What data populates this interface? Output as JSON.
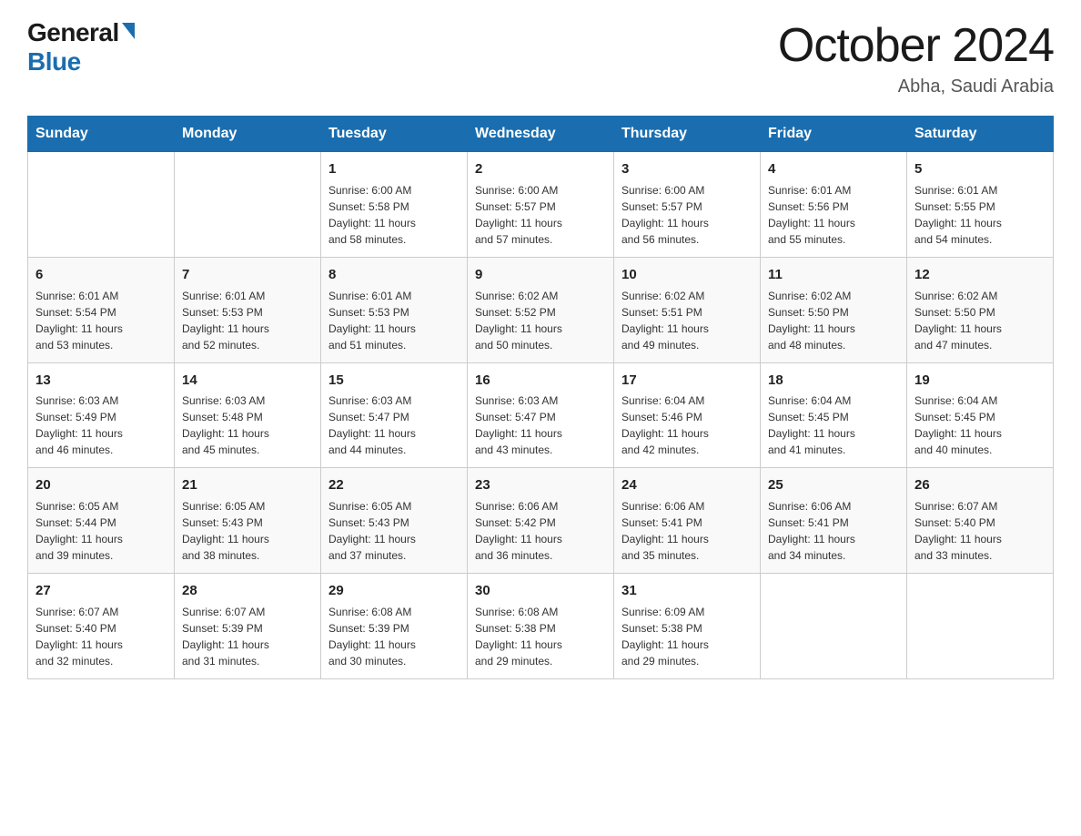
{
  "logo": {
    "general": "General",
    "blue": "Blue"
  },
  "title": "October 2024",
  "location": "Abha, Saudi Arabia",
  "headers": [
    "Sunday",
    "Monday",
    "Tuesday",
    "Wednesday",
    "Thursday",
    "Friday",
    "Saturday"
  ],
  "weeks": [
    [
      {
        "day": "",
        "info": ""
      },
      {
        "day": "",
        "info": ""
      },
      {
        "day": "1",
        "info": "Sunrise: 6:00 AM\nSunset: 5:58 PM\nDaylight: 11 hours\nand 58 minutes."
      },
      {
        "day": "2",
        "info": "Sunrise: 6:00 AM\nSunset: 5:57 PM\nDaylight: 11 hours\nand 57 minutes."
      },
      {
        "day": "3",
        "info": "Sunrise: 6:00 AM\nSunset: 5:57 PM\nDaylight: 11 hours\nand 56 minutes."
      },
      {
        "day": "4",
        "info": "Sunrise: 6:01 AM\nSunset: 5:56 PM\nDaylight: 11 hours\nand 55 minutes."
      },
      {
        "day": "5",
        "info": "Sunrise: 6:01 AM\nSunset: 5:55 PM\nDaylight: 11 hours\nand 54 minutes."
      }
    ],
    [
      {
        "day": "6",
        "info": "Sunrise: 6:01 AM\nSunset: 5:54 PM\nDaylight: 11 hours\nand 53 minutes."
      },
      {
        "day": "7",
        "info": "Sunrise: 6:01 AM\nSunset: 5:53 PM\nDaylight: 11 hours\nand 52 minutes."
      },
      {
        "day": "8",
        "info": "Sunrise: 6:01 AM\nSunset: 5:53 PM\nDaylight: 11 hours\nand 51 minutes."
      },
      {
        "day": "9",
        "info": "Sunrise: 6:02 AM\nSunset: 5:52 PM\nDaylight: 11 hours\nand 50 minutes."
      },
      {
        "day": "10",
        "info": "Sunrise: 6:02 AM\nSunset: 5:51 PM\nDaylight: 11 hours\nand 49 minutes."
      },
      {
        "day": "11",
        "info": "Sunrise: 6:02 AM\nSunset: 5:50 PM\nDaylight: 11 hours\nand 48 minutes."
      },
      {
        "day": "12",
        "info": "Sunrise: 6:02 AM\nSunset: 5:50 PM\nDaylight: 11 hours\nand 47 minutes."
      }
    ],
    [
      {
        "day": "13",
        "info": "Sunrise: 6:03 AM\nSunset: 5:49 PM\nDaylight: 11 hours\nand 46 minutes."
      },
      {
        "day": "14",
        "info": "Sunrise: 6:03 AM\nSunset: 5:48 PM\nDaylight: 11 hours\nand 45 minutes."
      },
      {
        "day": "15",
        "info": "Sunrise: 6:03 AM\nSunset: 5:47 PM\nDaylight: 11 hours\nand 44 minutes."
      },
      {
        "day": "16",
        "info": "Sunrise: 6:03 AM\nSunset: 5:47 PM\nDaylight: 11 hours\nand 43 minutes."
      },
      {
        "day": "17",
        "info": "Sunrise: 6:04 AM\nSunset: 5:46 PM\nDaylight: 11 hours\nand 42 minutes."
      },
      {
        "day": "18",
        "info": "Sunrise: 6:04 AM\nSunset: 5:45 PM\nDaylight: 11 hours\nand 41 minutes."
      },
      {
        "day": "19",
        "info": "Sunrise: 6:04 AM\nSunset: 5:45 PM\nDaylight: 11 hours\nand 40 minutes."
      }
    ],
    [
      {
        "day": "20",
        "info": "Sunrise: 6:05 AM\nSunset: 5:44 PM\nDaylight: 11 hours\nand 39 minutes."
      },
      {
        "day": "21",
        "info": "Sunrise: 6:05 AM\nSunset: 5:43 PM\nDaylight: 11 hours\nand 38 minutes."
      },
      {
        "day": "22",
        "info": "Sunrise: 6:05 AM\nSunset: 5:43 PM\nDaylight: 11 hours\nand 37 minutes."
      },
      {
        "day": "23",
        "info": "Sunrise: 6:06 AM\nSunset: 5:42 PM\nDaylight: 11 hours\nand 36 minutes."
      },
      {
        "day": "24",
        "info": "Sunrise: 6:06 AM\nSunset: 5:41 PM\nDaylight: 11 hours\nand 35 minutes."
      },
      {
        "day": "25",
        "info": "Sunrise: 6:06 AM\nSunset: 5:41 PM\nDaylight: 11 hours\nand 34 minutes."
      },
      {
        "day": "26",
        "info": "Sunrise: 6:07 AM\nSunset: 5:40 PM\nDaylight: 11 hours\nand 33 minutes."
      }
    ],
    [
      {
        "day": "27",
        "info": "Sunrise: 6:07 AM\nSunset: 5:40 PM\nDaylight: 11 hours\nand 32 minutes."
      },
      {
        "day": "28",
        "info": "Sunrise: 6:07 AM\nSunset: 5:39 PM\nDaylight: 11 hours\nand 31 minutes."
      },
      {
        "day": "29",
        "info": "Sunrise: 6:08 AM\nSunset: 5:39 PM\nDaylight: 11 hours\nand 30 minutes."
      },
      {
        "day": "30",
        "info": "Sunrise: 6:08 AM\nSunset: 5:38 PM\nDaylight: 11 hours\nand 29 minutes."
      },
      {
        "day": "31",
        "info": "Sunrise: 6:09 AM\nSunset: 5:38 PM\nDaylight: 11 hours\nand 29 minutes."
      },
      {
        "day": "",
        "info": ""
      },
      {
        "day": "",
        "info": ""
      }
    ]
  ]
}
